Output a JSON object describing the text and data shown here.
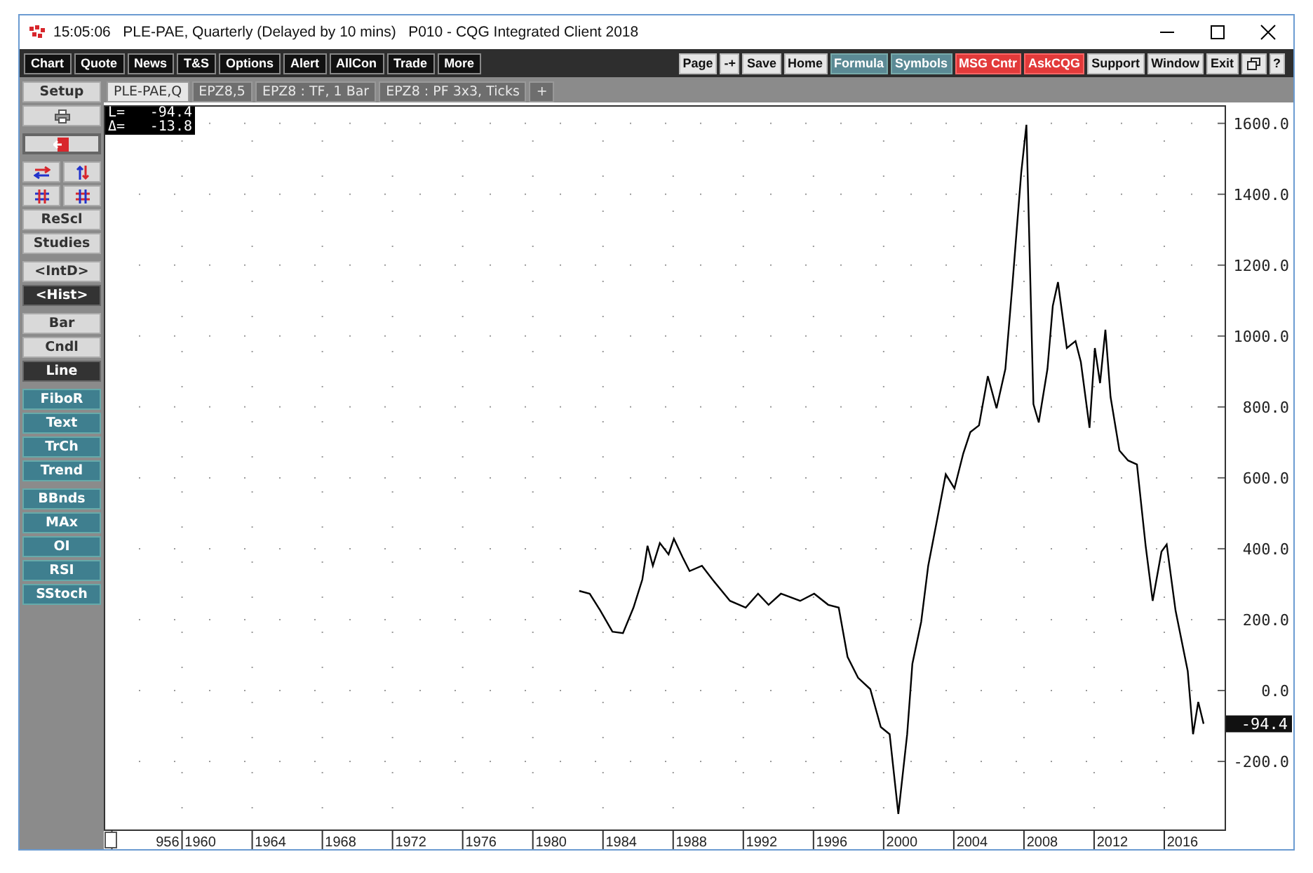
{
  "window": {
    "title": "15:05:06   PLE-PAE, Quarterly (Delayed by 10 mins)   P010 - CQG Integrated Client 2018"
  },
  "toolbar_left": [
    "Chart",
    "Quote",
    "News",
    "T&S",
    "Options",
    "Alert",
    "AllCon",
    "Trade",
    "More"
  ],
  "toolbar_right": [
    {
      "label": "Page",
      "kind": "plain"
    },
    {
      "label": "-+",
      "kind": "plain"
    },
    {
      "label": "Save",
      "kind": "plain"
    },
    {
      "label": "Home",
      "kind": "plain"
    },
    {
      "label": "Formula",
      "kind": "teal"
    },
    {
      "label": "Symbols",
      "kind": "teal"
    },
    {
      "label": "MSG Cntr",
      "kind": "alert"
    },
    {
      "label": "AskCQG",
      "kind": "alert"
    },
    {
      "label": "Support",
      "kind": "plain"
    },
    {
      "label": "Window",
      "kind": "plain"
    },
    {
      "label": "Exit",
      "kind": "plain"
    },
    {
      "kind": "restore"
    },
    {
      "label": "?",
      "kind": "plain"
    }
  ],
  "tabs": [
    {
      "label": "PLE-PAE,Q",
      "selected": true
    },
    {
      "label": "EPZ8,5",
      "selected": false
    },
    {
      "label": "EPZ8 : TF, 1 Bar",
      "selected": false
    },
    {
      "label": "EPZ8 : PF 3x3, Ticks",
      "selected": false
    },
    {
      "label": "+",
      "selected": false
    }
  ],
  "sidebar": [
    [
      {
        "kind": "light",
        "label": "Setup",
        "selected": false
      },
      {
        "kind": "printer"
      }
    ],
    [
      {
        "kind": "exit"
      }
    ],
    [
      {
        "kind": "arrows"
      },
      {
        "kind": "grids"
      },
      {
        "kind": "light",
        "label": "ReScl",
        "selected": false
      },
      {
        "kind": "light",
        "label": "Studies",
        "selected": false
      }
    ],
    [
      {
        "kind": "light",
        "label": "<IntD>",
        "selected": false
      },
      {
        "kind": "light",
        "label": "<Hist>",
        "selected": true
      }
    ],
    [
      {
        "kind": "light",
        "label": "Bar",
        "selected": false
      },
      {
        "kind": "light",
        "label": "Cndl",
        "selected": false
      },
      {
        "kind": "light",
        "label": "Line",
        "selected": true
      }
    ],
    [
      {
        "kind": "teal",
        "label": "FiboR",
        "selected": false
      },
      {
        "kind": "teal",
        "label": "Text",
        "selected": false
      },
      {
        "kind": "teal",
        "label": "TrCh",
        "selected": false
      },
      {
        "kind": "teal",
        "label": "Trend",
        "selected": false
      }
    ],
    [
      {
        "kind": "teal",
        "label": "BBnds",
        "selected": false
      },
      {
        "kind": "teal",
        "label": "MAx",
        "selected": false
      },
      {
        "kind": "teal",
        "label": "OI",
        "selected": false
      },
      {
        "kind": "teal",
        "label": "RSI",
        "selected": false
      },
      {
        "kind": "teal",
        "label": "SStoch",
        "selected": false
      }
    ]
  ],
  "readout": [
    {
      "label": "L=",
      "value": "-94.4"
    },
    {
      "label": "Δ=",
      "value": "-13.8"
    }
  ],
  "last_price": "-94.4",
  "chart": {
    "x_axis_cut_label": "956",
    "chart_data": {
      "type": "line",
      "grid": true,
      "xlim": [
        1954.5,
        2018.4
      ],
      "ylim": [
        -392,
        1651
      ],
      "x": [
        1981.6,
        1982.2,
        1982.8,
        1983.5,
        1984.1,
        1984.7,
        1985.2,
        1985.5,
        1985.8,
        1986.2,
        1986.7,
        1987.0,
        1987.5,
        1987.9,
        1988.6,
        1989.2,
        1990.2,
        1991.1,
        1991.8,
        1992.4,
        1993.1,
        1994.2,
        1995.0,
        1995.8,
        1996.4,
        1996.9,
        1997.5,
        1998.2,
        1998.8,
        1999.3,
        1999.8,
        2000.3,
        2000.6,
        2001.1,
        2001.5,
        2002.0,
        2002.5,
        2003.0,
        2003.5,
        2003.9,
        2004.4,
        2004.9,
        2005.4,
        2005.9,
        2006.3,
        2006.8,
        2007.1,
        2007.5,
        2007.8,
        2008.3,
        2008.6,
        2008.9,
        2009.4,
        2009.9,
        2010.2,
        2010.7,
        2011.0,
        2011.3,
        2011.6,
        2011.9,
        2012.4,
        2012.9,
        2013.4,
        2013.9,
        2014.3,
        2014.8,
        2015.1,
        2015.6,
        2016.3,
        2016.6,
        2016.9,
        2017.2
      ],
      "series": [
        {
          "color": "#000000",
          "values": [
            281,
            273,
            226,
            166,
            162,
            234,
            313,
            408,
            352,
            416,
            384,
            428,
            376,
            337,
            352,
            313,
            253,
            234,
            273,
            242,
            273,
            253,
            273,
            242,
            234,
            95,
            36,
            4,
            -103,
            -123,
            -348,
            -123,
            75,
            194,
            352,
            479,
            610,
            570,
            669,
            729,
            748,
            887,
            796,
            907,
            1144,
            1461,
            1596,
            808,
            756,
            907,
            1085,
            1152,
            966,
            986,
            927,
            741,
            966,
            867,
            1018,
            828,
            677,
            649,
            638,
            408,
            253,
            392,
            412,
            226,
            55,
            -123,
            -32,
            -94
          ]
        }
      ],
      "xticks": [
        1960,
        1964,
        1968,
        1972,
        1976,
        1980,
        1984,
        1988,
        1992,
        1996,
        2000,
        2004,
        2008,
        2012,
        2016
      ],
      "yticks": [
        {
          "value": -200,
          "label": "-200.0"
        },
        {
          "value": 0,
          "label": "0.0"
        },
        {
          "value": 200,
          "label": "200.0"
        },
        {
          "value": 400,
          "label": "400.0"
        },
        {
          "value": 600,
          "label": "600.0"
        },
        {
          "value": 800,
          "label": "800.0"
        },
        {
          "value": 1000,
          "label": "1000.0"
        },
        {
          "value": 1200,
          "label": "1200.0"
        },
        {
          "value": 1400,
          "label": "1400.0"
        },
        {
          "value": 1600,
          "label": "1600.0"
        }
      ]
    }
  }
}
